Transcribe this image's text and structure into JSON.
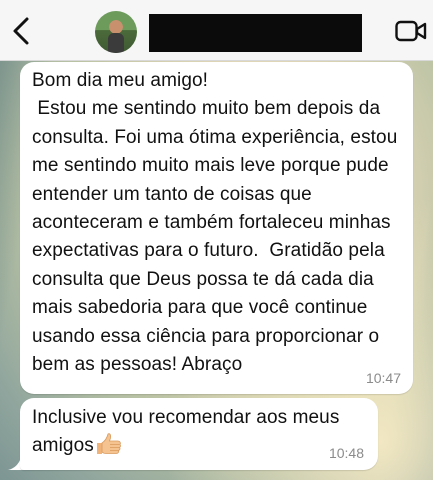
{
  "header": {
    "back_icon": "chevron-left-icon",
    "avatar": "contact-avatar",
    "video_icon": "video-camera-icon"
  },
  "messages": [
    {
      "text": "Bom dia meu amigo!\n Estou me sentindo muito bem depois da consulta. Foi uma ótima experiência, estou me sentindo muito mais leve porque pude entender um tanto de coisas que aconteceram e também fortaleceu minhas expectativas para o futuro.  Gratidão pela consulta que Deus possa te dá cada dia  mais sabedoria para que você continue usando essa ciência para proporcionar o bem as pessoas! Abraço",
      "time": "10:47"
    },
    {
      "text": "Inclusive vou recomendar aos meus amigos",
      "emoji": "thumbs-up-emoji",
      "time": "10:48"
    }
  ],
  "colors": {
    "header_bg": "#f6f6f6",
    "bubble_bg": "#ffffff",
    "timestamp": "#8b8b8b"
  }
}
